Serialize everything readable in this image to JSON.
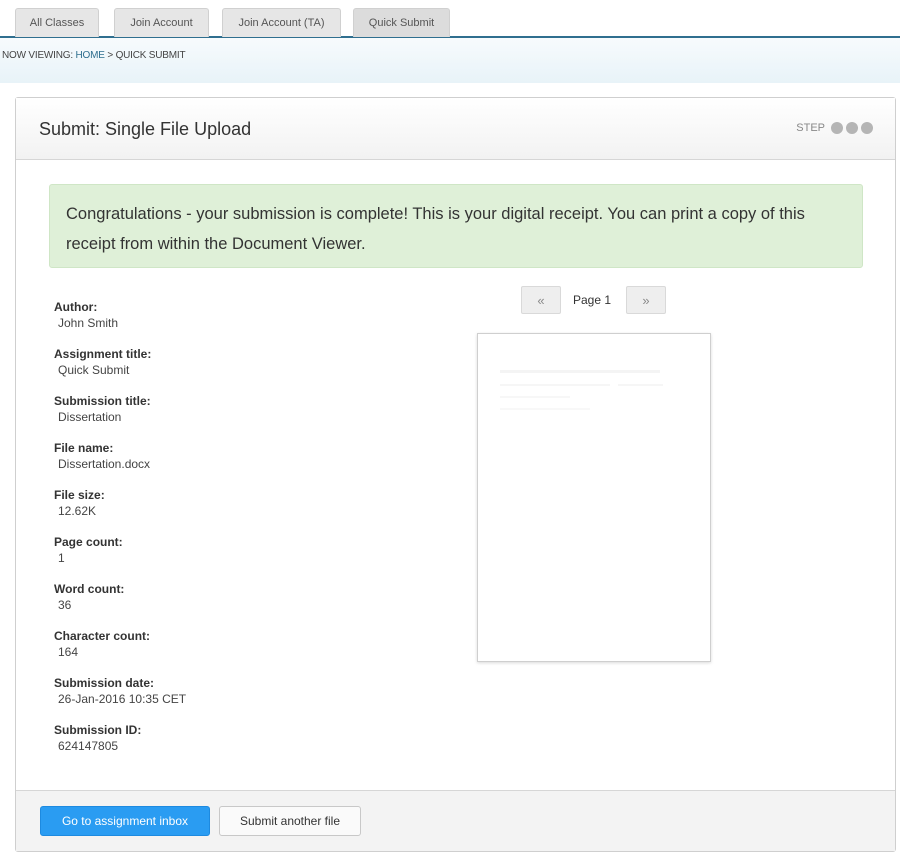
{
  "tabs": [
    {
      "label": "All Classes"
    },
    {
      "label": "Join Account"
    },
    {
      "label": "Join Account (TA)"
    },
    {
      "label": "Quick Submit"
    }
  ],
  "breadcrumb": {
    "prefix": "NOW VIEWING:",
    "home": "HOME",
    "separator": ">",
    "current": "QUICK SUBMIT"
  },
  "panel": {
    "title": "Submit: Single File Upload",
    "step_label": "STEP"
  },
  "banner": {
    "message": "Congratulations - your submission is complete! This is your digital receipt. You can print a copy of this receipt from within the Document Viewer."
  },
  "receipt": [
    {
      "label": "Author:",
      "value": "John Smith"
    },
    {
      "label": "Assignment title:",
      "value": "Quick Submit"
    },
    {
      "label": "Submission title:",
      "value": "Dissertation"
    },
    {
      "label": "File name:",
      "value": "Dissertation.docx"
    },
    {
      "label": "File size:",
      "value": "12.62K"
    },
    {
      "label": "Page count:",
      "value": "1"
    },
    {
      "label": "Word count:",
      "value": "36"
    },
    {
      "label": "Character count:",
      "value": "164"
    },
    {
      "label": "Submission date:",
      "value": "26-Jan-2016 10:35 CET"
    },
    {
      "label": "Submission ID:",
      "value": "624147805"
    }
  ],
  "viewer": {
    "prev_label": "«",
    "next_label": "»",
    "page_label": "Page 1"
  },
  "footer": {
    "primary_label": "Go to assignment inbox",
    "secondary_label": "Submit another file"
  },
  "colors": {
    "accent": "#2a9cf2",
    "tab_border": "#2f6f8f",
    "success_bg": "#dff0d8"
  }
}
